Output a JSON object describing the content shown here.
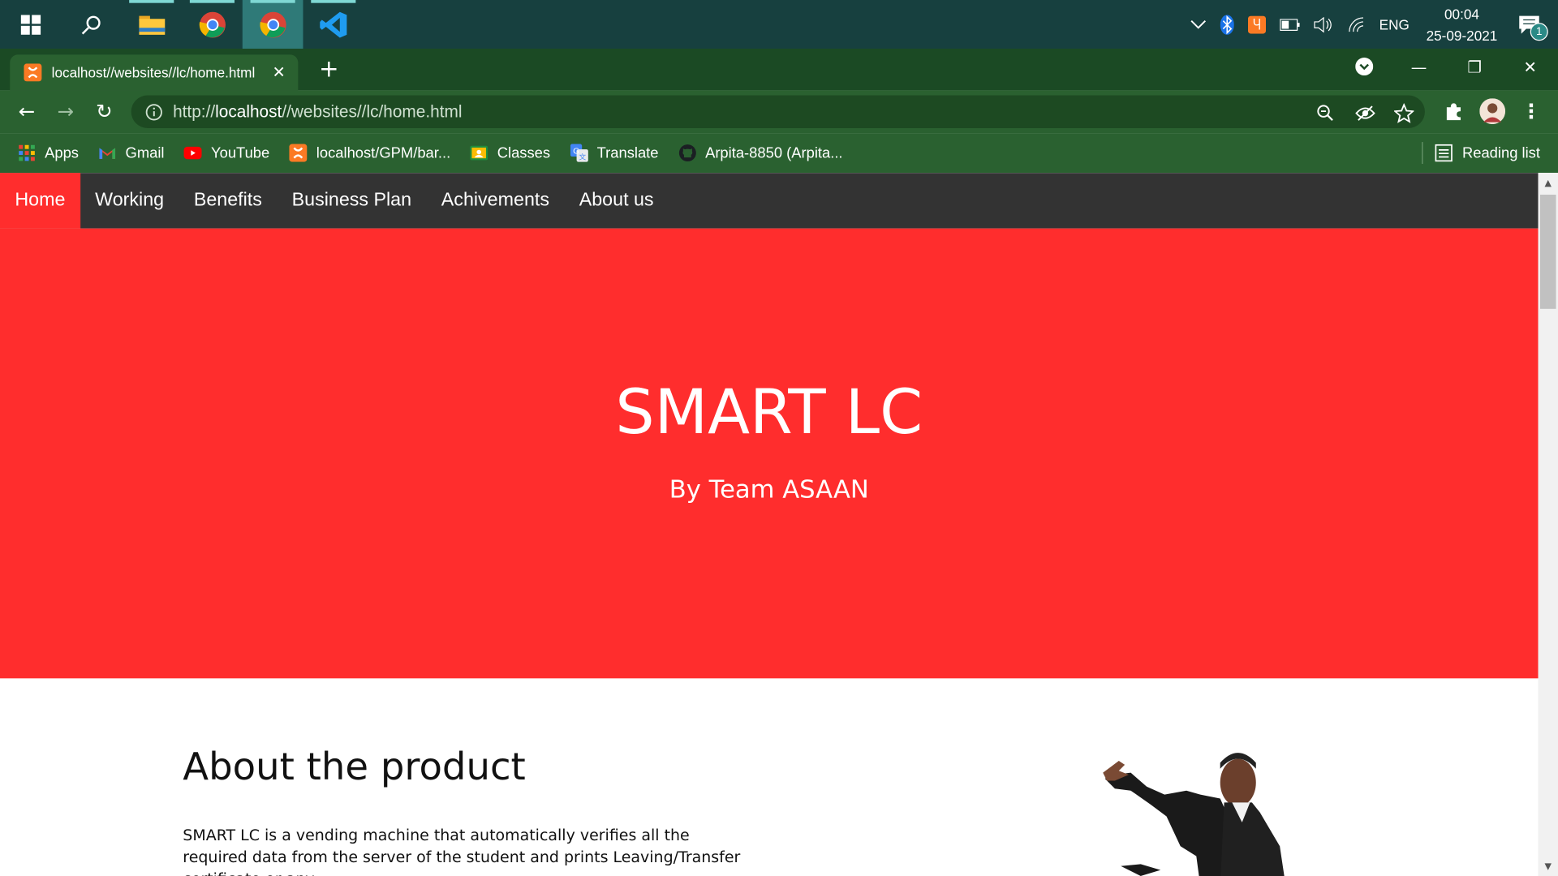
{
  "taskbar": {
    "lang": "ENG",
    "time": "00:04",
    "date": "25-09-2021",
    "notification_count": "1"
  },
  "browser": {
    "tab_title": "localhost//websites//lc/home.html",
    "url_prefix": "http://",
    "url_host": "localhost",
    "url_path": "//websites//lc/home.html",
    "bookmarks": [
      {
        "label": "Apps",
        "icon": "apps-grid-icon"
      },
      {
        "label": "Gmail",
        "icon": "gmail-icon"
      },
      {
        "label": "YouTube",
        "icon": "youtube-icon"
      },
      {
        "label": "localhost/GPM/bar...",
        "icon": "xampp-icon"
      },
      {
        "label": "Classes",
        "icon": "classroom-icon"
      },
      {
        "label": "Translate",
        "icon": "translate-icon"
      },
      {
        "label": "Arpita-8850 (Arpita...",
        "icon": "github-icon"
      }
    ],
    "reading_list": "Reading list"
  },
  "page": {
    "nav": [
      "Home",
      "Working",
      "Benefits",
      "Business Plan",
      "Achivements",
      "About us"
    ],
    "hero_title": "SMART LC",
    "hero_subtitle": "By Team ASAAN",
    "about_title": "About the product",
    "about_text": "SMART LC is a vending machine that automatically verifies all the required data from the server of the student and prints Leaving/Transfer certificate or any"
  },
  "colors": {
    "taskbar": "#17403f",
    "browser_frame": "#2a6130",
    "nav_bg": "#333333",
    "hero_red": "#ff2d2d"
  }
}
